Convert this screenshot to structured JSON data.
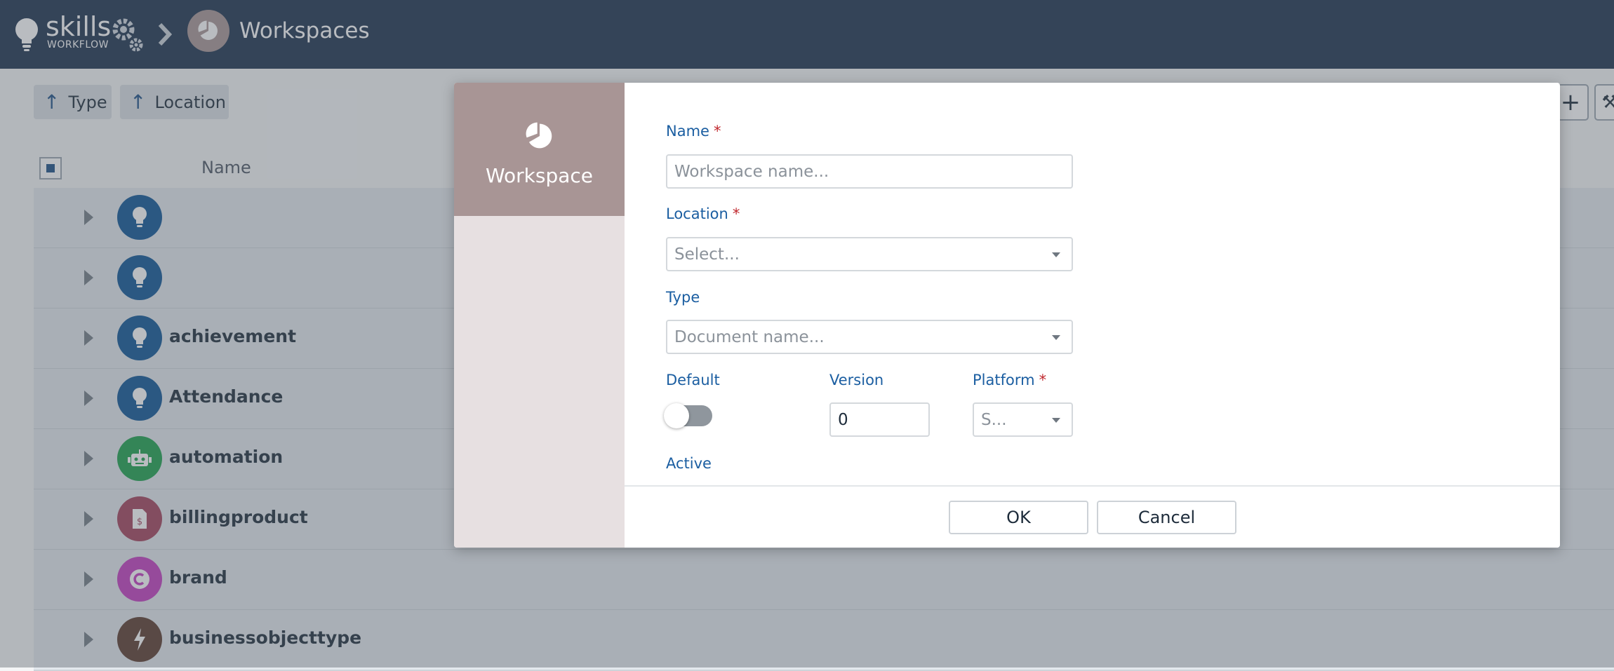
{
  "app": {
    "logo_word": "skills",
    "logo_sub": "WORKFLOW",
    "page_title": "Workspaces"
  },
  "filters": [
    {
      "label": "Type"
    },
    {
      "label": "Location"
    }
  ],
  "list": {
    "header_name": "Name",
    "rows": [
      {
        "label": "",
        "icon": "lightbulb-icon",
        "color": "#0b5394"
      },
      {
        "label": "",
        "icon": "lightbulb-icon",
        "color": "#0b5394"
      },
      {
        "label": "achievement",
        "icon": "lightbulb-icon",
        "color": "#0b5394"
      },
      {
        "label": "Attendance",
        "icon": "lightbulb-icon",
        "color": "#0b5394"
      },
      {
        "label": "automation",
        "icon": "robot-icon",
        "color": "#1aa04a"
      },
      {
        "label": "billingproduct",
        "icon": "invoice-icon",
        "color": "#a3405a"
      },
      {
        "label": "brand",
        "icon": "copyright-icon",
        "color": "#c33bbf"
      },
      {
        "label": "businessobjecttype",
        "icon": "bolt-icon",
        "color": "#5a3a2c"
      }
    ]
  },
  "modal": {
    "side_title": "Workspace",
    "name": {
      "label": "Name",
      "required_mark": "*",
      "placeholder": "Workspace name...",
      "value": ""
    },
    "location": {
      "label": "Location",
      "required_mark": "*",
      "placeholder": "Select..."
    },
    "type": {
      "label": "Type",
      "placeholder": "Document name..."
    },
    "default": {
      "label": "Default",
      "on": false
    },
    "version": {
      "label": "Version",
      "value": "0"
    },
    "platform": {
      "label": "Platform",
      "required_mark": "*",
      "placeholder": "S..."
    },
    "active": {
      "label": "Active"
    },
    "ok_label": "OK",
    "cancel_label": "Cancel"
  },
  "colors": {
    "topbar": "#1b314d",
    "accent_label": "#1b5ea1",
    "workspace_brand": "#a89595",
    "required": "#c0272d"
  }
}
